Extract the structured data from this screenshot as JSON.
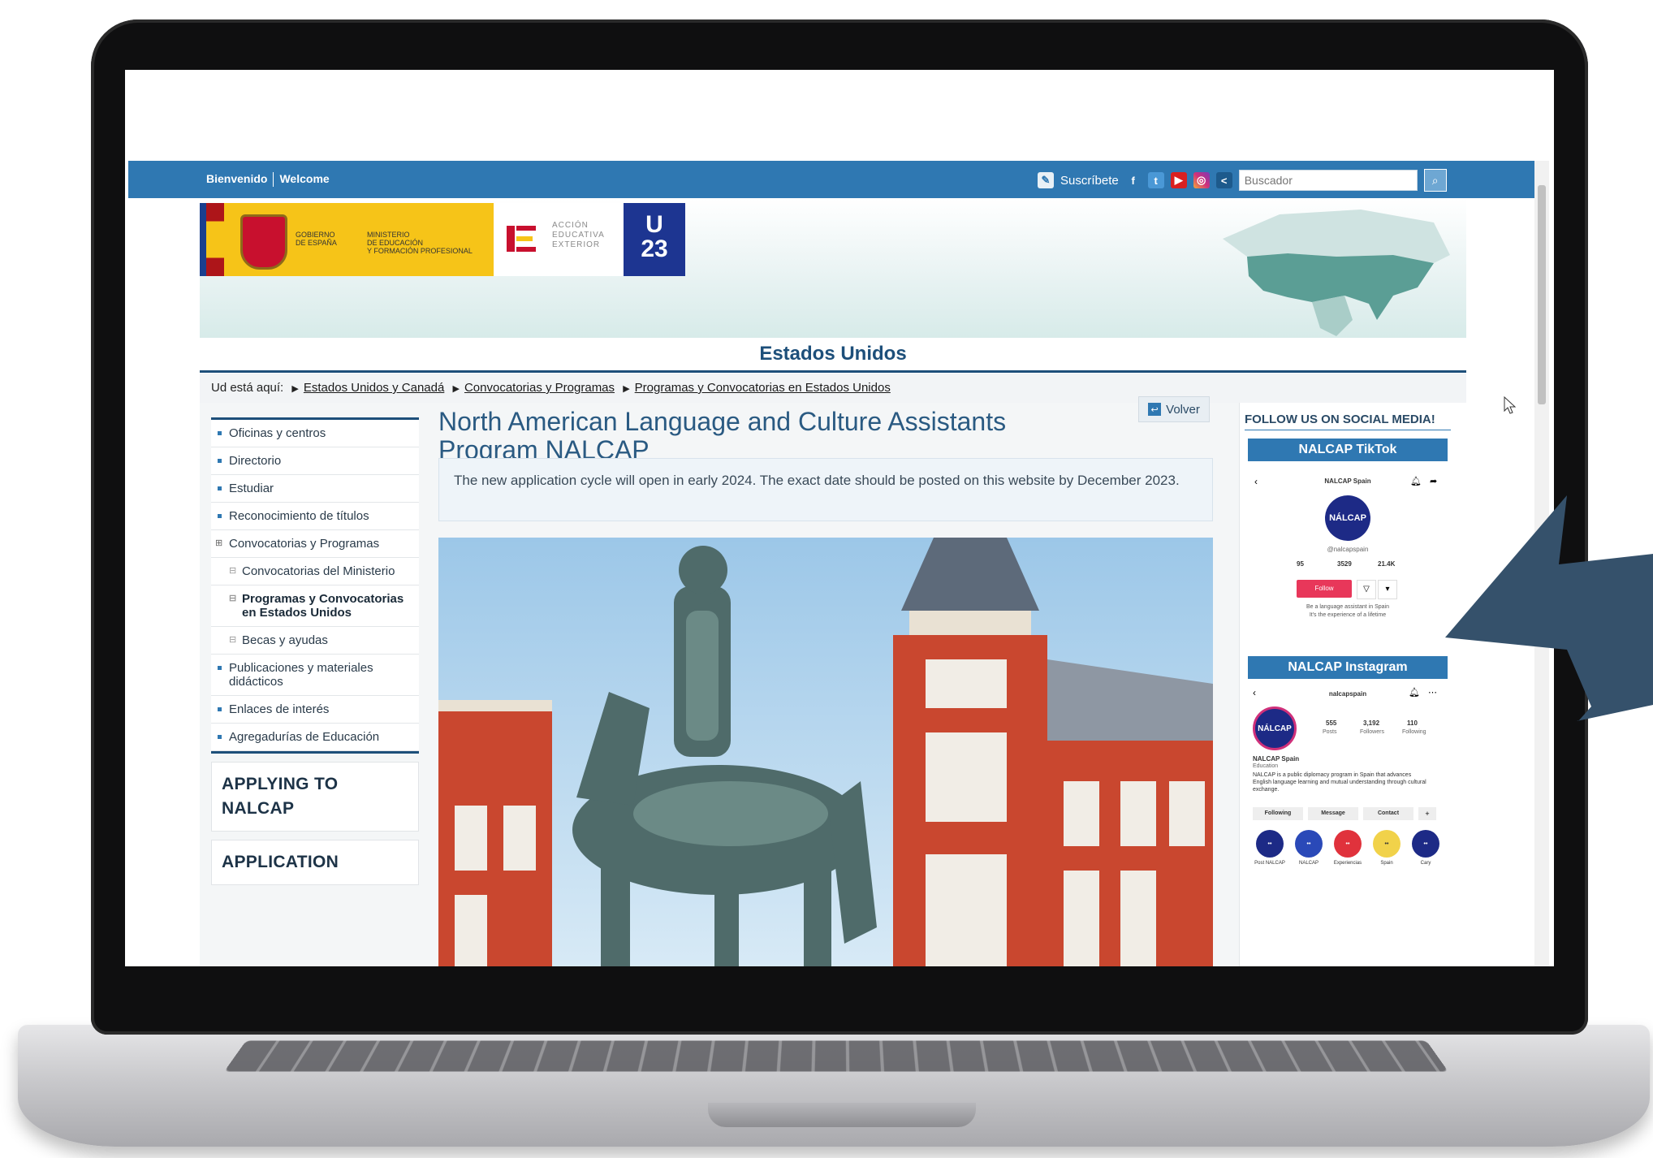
{
  "topbar": {
    "welcome_es": "Bienvenido",
    "welcome_en": "Welcome",
    "subscribe": "Suscríbete",
    "search_placeholder": "Buscador"
  },
  "logos": {
    "gov_line1": "GOBIERNO",
    "gov_line2": "DE ESPAÑA",
    "min_line1": "MINISTERIO",
    "min_line2": "DE EDUCACIÓN",
    "min_line3": "Y FORMACIÓN PROFESIONAL",
    "aee_line1": "ACCIÓN",
    "aee_line2": "EDUCATIVA",
    "aee_line3": "EXTERIOR",
    "u23_line1": "U",
    "u23_line2": "23"
  },
  "header": {
    "country_title": "Estados Unidos"
  },
  "breadcrumb": {
    "prefix": "Ud está aquí:",
    "items": [
      "Estados Unidos y Canadá",
      "Convocatorias y Programas",
      "Programas y Convocatorias en Estados Unidos"
    ]
  },
  "nav": {
    "items": [
      "Oficinas y centros",
      "Directorio",
      "Estudiar",
      "Reconocimiento de títulos",
      "Convocatorias y Programas",
      "Convocatorias del Ministerio",
      "Programas y Convocatorias en Estados Unidos",
      "Becas y ayudas",
      "Publicaciones y materiales didácticos",
      "Enlaces de interés",
      "Agregadurías de Educación"
    ],
    "card1": "APPLYING TO NALCAP",
    "card2": "APPLICATION"
  },
  "main": {
    "back_label": "Volver",
    "title": "North American Language and Culture Assistants Program NALCAP",
    "notice": "The new application cycle will open in early 2024. The exact date should be posted on this website by December 2023."
  },
  "social": {
    "follow_title": "FOLLOW US ON SOCIAL MEDIA!",
    "tiktok_header": "NALCAP TikTok",
    "tiktok_name": "NALCAP Spain",
    "tiktok_handle": "@nalcapspain",
    "tiktok_stats": [
      "95",
      "3529",
      "21.4K"
    ],
    "tiktok_follow": "Follow",
    "tiktok_bio1": "Be a language assistant in Spain",
    "tiktok_bio2": "It's the experience of a lifetime",
    "instagram_header": "NALCAP Instagram",
    "ig_name": "nalcapspain",
    "ig_stats": [
      "555",
      "3,192",
      "110"
    ],
    "ig_stat_labels": [
      "Posts",
      "Followers",
      "Following"
    ],
    "ig_display_name": "NALCAP Spain",
    "ig_category": "Education",
    "ig_bio": "NALCAP is a public diplomacy program in Spain that advances English language learning and mutual understanding through cultural exchange.",
    "ig_buttons": [
      "Following",
      "Message",
      "Contact"
    ],
    "ig_highlights": [
      "Post NALCAP",
      "NALCAP",
      "Experiencias",
      "Spain",
      "Cary"
    ]
  },
  "colors": {
    "brand_blue": "#2f78b2",
    "dark_blue": "#1d4f7a",
    "arrow": "#35516b"
  }
}
